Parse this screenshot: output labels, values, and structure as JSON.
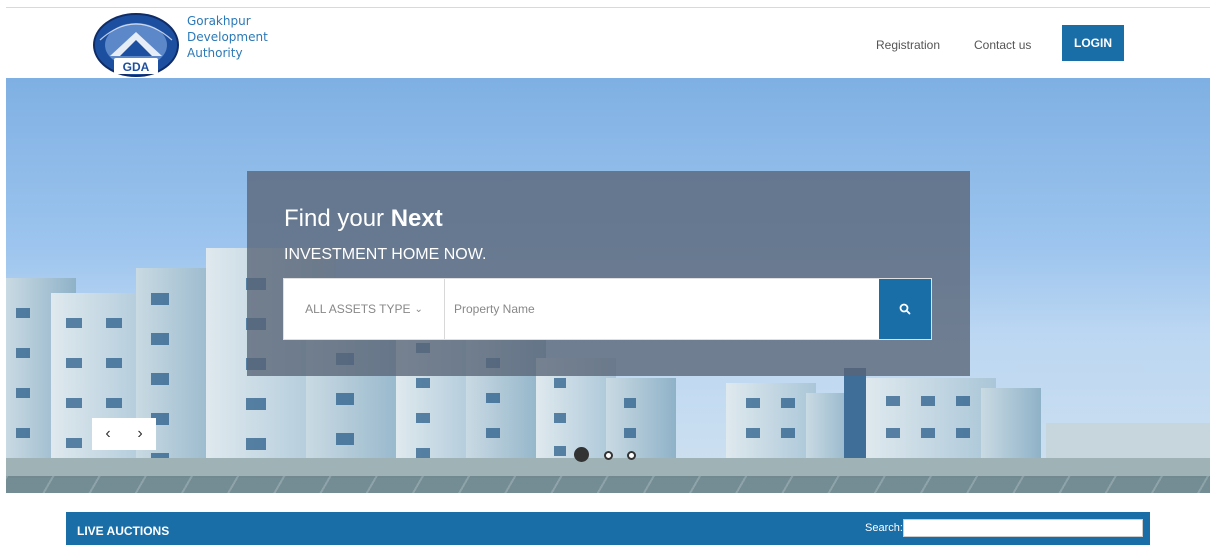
{
  "header": {
    "brand_line1": "Gorakhpur",
    "brand_line2": "Development",
    "brand_line3": "Authority",
    "logo_text": "GDA",
    "nav_registration": "Registration",
    "nav_contact": "Contact us",
    "login_label": "LOGIN"
  },
  "hero": {
    "title_prefix": "Find your ",
    "title_bold": "Next",
    "subtitle": "INVESTMENT HOME NOW.",
    "asset_type_label": "ALL ASSETS TYPE",
    "property_placeholder": "Property Name",
    "search_icon": "search-icon",
    "prev_arrow": "‹",
    "next_arrow": "›",
    "slide_count": 3,
    "active_slide": 1
  },
  "auctions": {
    "title": "LIVE AUCTIONS",
    "search_label": "Search:"
  },
  "colors": {
    "primary_blue": "#1a6ea8",
    "brand_text": "#2b79b7"
  }
}
